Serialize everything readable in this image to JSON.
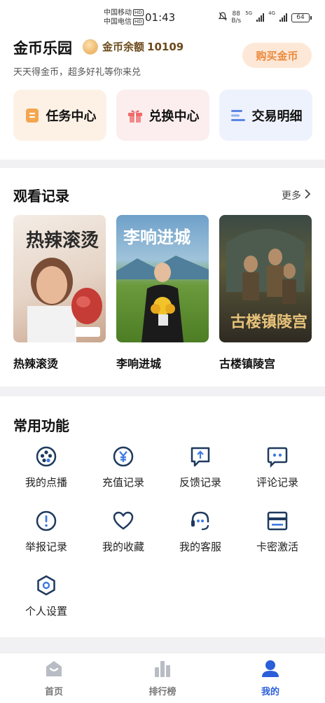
{
  "status_bar": {
    "carrier_1": "中国移动",
    "carrier_2": "中国电信",
    "hd": "HD",
    "time": "01:43",
    "net_speed_value": "88",
    "net_speed_unit": "B/s",
    "signal_1": "5G",
    "signal_2": "4G",
    "battery": "64"
  },
  "gold": {
    "title": "金币乐园",
    "balance_label": "金币余额",
    "balance_value": "10109",
    "buy_button": "购买金币",
    "subtitle": "天天得金币，超多好礼等你来兑"
  },
  "quick_tiles": [
    {
      "label": "任务中心",
      "icon": "task-icon"
    },
    {
      "label": "兑换中心",
      "icon": "gift-icon"
    },
    {
      "label": "交易明细",
      "icon": "list-icon"
    }
  ],
  "watch_history": {
    "title": "观看记录",
    "more": "更多",
    "items": [
      {
        "title": "热辣滚烫"
      },
      {
        "title": "李响进城"
      },
      {
        "title": "古楼镇陵宫"
      }
    ]
  },
  "functions": {
    "title": "常用功能",
    "items": [
      {
        "label": "我的点播",
        "icon": "film-reel-icon"
      },
      {
        "label": "充值记录",
        "icon": "yen-circle-icon"
      },
      {
        "label": "反馈记录",
        "icon": "feedback-icon"
      },
      {
        "label": "评论记录",
        "icon": "comment-icon"
      },
      {
        "label": "举报记录",
        "icon": "alert-icon"
      },
      {
        "label": "我的收藏",
        "icon": "heart-icon"
      },
      {
        "label": "我的客服",
        "icon": "headset-icon"
      },
      {
        "label": "卡密激活",
        "icon": "card-icon"
      },
      {
        "label": "个人设置",
        "icon": "settings-hex-icon"
      }
    ]
  },
  "bottom_nav": {
    "items": [
      {
        "label": "首页",
        "icon": "home-icon"
      },
      {
        "label": "排行榜",
        "icon": "ranking-icon"
      },
      {
        "label": "我的",
        "icon": "profile-icon"
      }
    ],
    "active": "我的",
    "active_color": "#2b5fd9"
  },
  "colors": {
    "accent_orange": "#ea8a3c",
    "buy_bg": "#fde8d7",
    "page_bg": "#f1f1f3"
  }
}
